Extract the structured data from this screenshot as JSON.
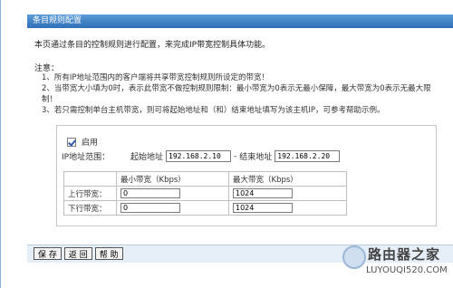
{
  "window": {
    "title": "条目规则配置"
  },
  "intro": "本页通过条目的控制规则进行配置，来完成IP带宽控制具体功能。",
  "notes": {
    "heading": "注意：",
    "lines": [
      "1、所有IP地址范围内的客户端将共享带宽控制规则所设定的带宽！",
      "2、当带宽大小填为0时，表示此带宽不做控制规则限制：最小带宽为0表示无最小保障，最大带宽为0表示无最大限制！",
      "3、若只需控制单台主机带宽，则可将起始地址和（和）结束地址填写为该主机IP，可参考帮助示例。"
    ]
  },
  "form": {
    "enable_label": "启用",
    "enabled": true,
    "ip_range_label": "IP地址范围：",
    "start_label": "起始地址",
    "start_value": "192.168.2.10",
    "sep": "-",
    "end_label": "结束地址",
    "end_value": "192.168.2.20"
  },
  "bandwidth": {
    "headers": [
      "",
      "最小带宽（Kbps）",
      "最大带宽（Kbps）"
    ],
    "rows": [
      {
        "label": "上行带宽：",
        "min": "0",
        "max": "1024"
      },
      {
        "label": "下行带宽：",
        "min": "0",
        "max": "1024"
      }
    ]
  },
  "buttons": {
    "save": "保 存",
    "back": "返 回",
    "help": "帮 助"
  },
  "watermark": {
    "cn": "路由器之家",
    "en": "LUYOUQI520.COM"
  }
}
